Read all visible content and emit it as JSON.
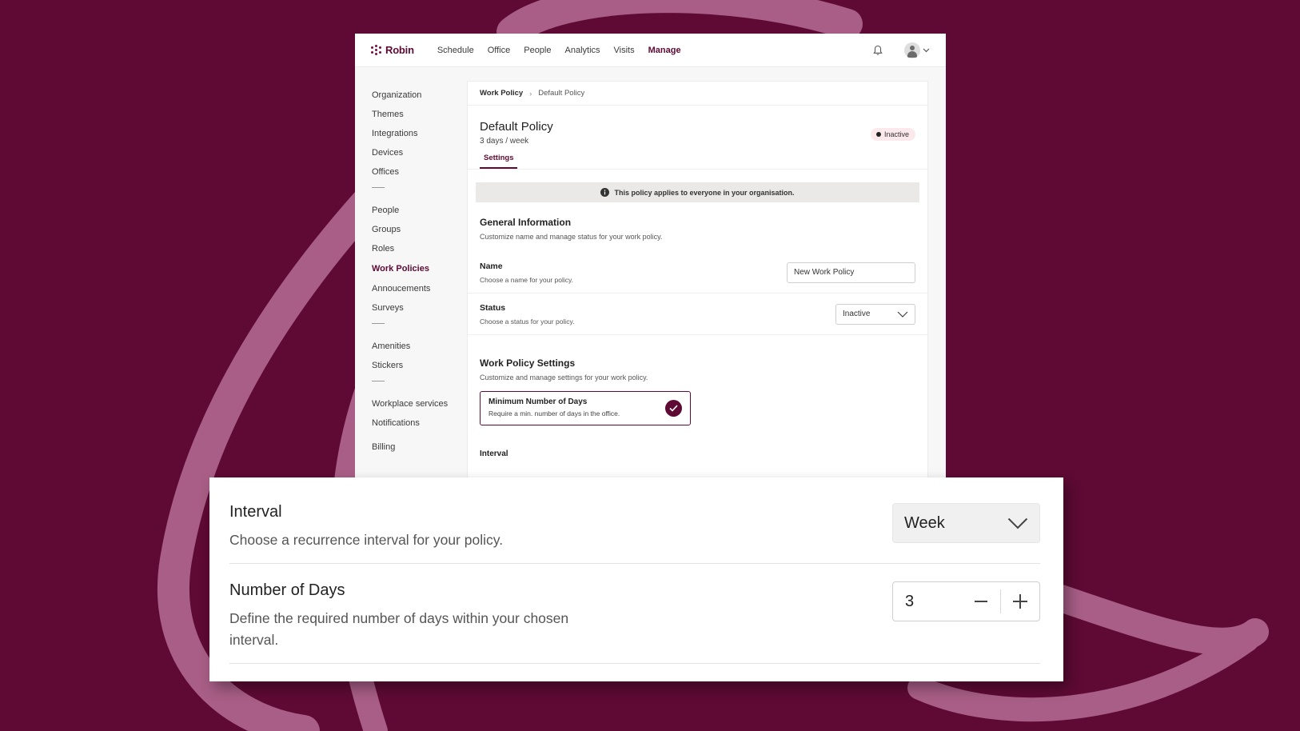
{
  "brand": {
    "name": "Robin",
    "color": "#5e0a34"
  },
  "topnav": {
    "links": [
      {
        "label": "Schedule",
        "active": false
      },
      {
        "label": "Office",
        "active": false
      },
      {
        "label": "People",
        "active": false
      },
      {
        "label": "Analytics",
        "active": false
      },
      {
        "label": "Visits",
        "active": false
      },
      {
        "label": "Manage",
        "active": true
      }
    ],
    "icons": [
      "bell-icon",
      "avatar",
      "chevron-down-icon"
    ]
  },
  "sidebar": {
    "groups": [
      [
        "Organization",
        "Themes",
        "Integrations",
        "Devices",
        "Offices"
      ],
      [
        "People",
        "Groups",
        "Roles",
        "Work Policies",
        "Annoucements",
        "Surveys"
      ],
      [
        "Amenities",
        "Stickers"
      ],
      [
        "Workplace services",
        "Notifications"
      ],
      [
        "Billing"
      ]
    ],
    "active": "Work Policies"
  },
  "breadcrumb": {
    "parent": "Work Policy",
    "separator": "›",
    "current": "Default Policy"
  },
  "policy": {
    "title": "Default Policy",
    "subtitle": "3 days / week",
    "status_badge": "Inactive"
  },
  "tabs": [
    {
      "label": "Settings",
      "active": true
    }
  ],
  "notice": {
    "text": "This policy applies to everyone in your organisation."
  },
  "general": {
    "title": "General Information",
    "desc": "Customize name and manage status for your work policy.",
    "name_label": "Name",
    "name_desc": "Choose a name for your policy.",
    "name_value": "New Work Policy",
    "status_label": "Status",
    "status_desc": "Choose a status for your policy.",
    "status_value": "Inactive"
  },
  "settings": {
    "title": "Work Policy Settings",
    "desc": "Customize and manage settings for your work policy.",
    "card_title": "Minimum Number of Days",
    "card_desc": "Require a min. number of days in the office.",
    "card_selected": true,
    "interval_label": "Interval"
  },
  "zoom": {
    "interval_label": "Interval",
    "interval_desc": "Choose a recurrence interval for your policy.",
    "interval_value": "Week",
    "days_label": "Number of Days",
    "days_desc": "Define the required number of days within your chosen interval.",
    "days_value": "3",
    "minus": "−",
    "plus": "+"
  }
}
